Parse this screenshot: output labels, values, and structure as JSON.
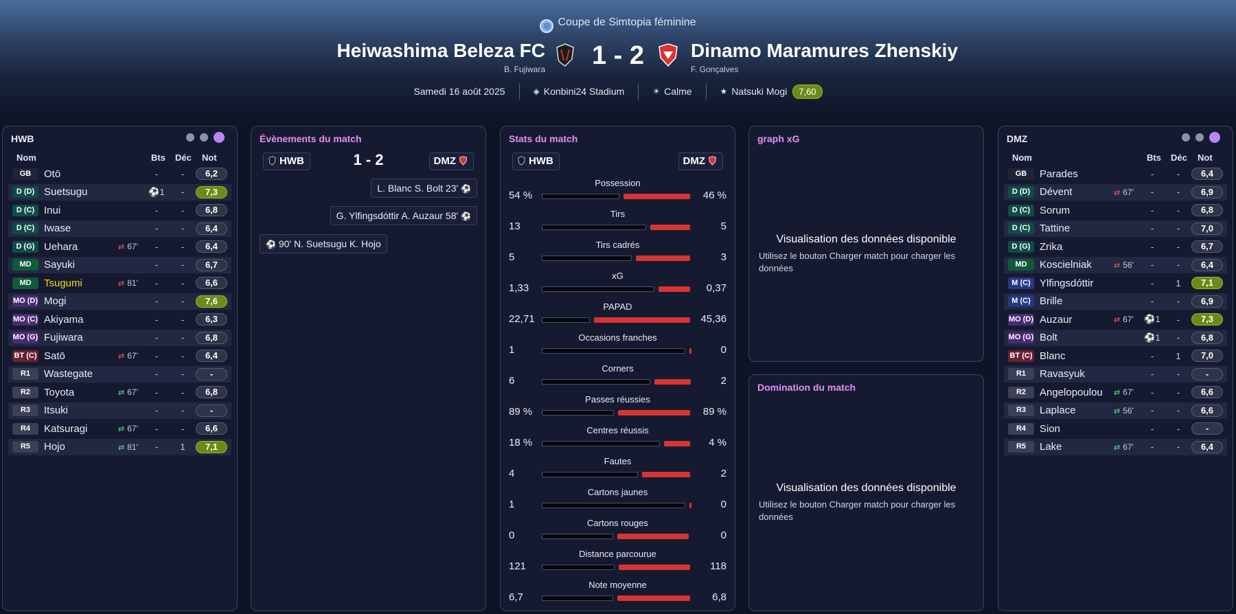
{
  "header": {
    "competition": "Coupe de Simtopia féminine",
    "home_team": "Heiwashima Beleza FC",
    "home_coach": "B. Fujiwara",
    "away_team": "Dinamo Maramures Zhenskiy",
    "away_coach": "F. Gonçalves",
    "score": "1 - 2",
    "date": "Samedi 16 août 2025",
    "stadium": "Konbini24 Stadium",
    "weather": "Calme",
    "motm_name": "Natsuki Mogi",
    "motm_rating": "7,60",
    "home_color": "#1c1c1c",
    "away_color": "#d83434"
  },
  "home_lineup": {
    "title": "HWB",
    "headers": {
      "name": "Nom",
      "goals": "Bts",
      "assists": "Déc",
      "rating": "Not"
    },
    "players": [
      {
        "pos": "GB",
        "name": "Otō",
        "sub": "",
        "goals": "-",
        "dec": "-",
        "rating": "6,2"
      },
      {
        "pos": "D (D)",
        "name": "Suetsugu",
        "sub": "",
        "goals": "⚽1",
        "dec": "-",
        "rating": "7,3"
      },
      {
        "pos": "D (C)",
        "name": "Inui",
        "sub": "",
        "goals": "-",
        "dec": "-",
        "rating": "6,8"
      },
      {
        "pos": "D (C)",
        "name": "Iwase",
        "sub": "",
        "goals": "-",
        "dec": "-",
        "rating": "6,4"
      },
      {
        "pos": "D (G)",
        "name": "Uehara",
        "sub": "67'",
        "goals": "-",
        "dec": "-",
        "rating": "6,4"
      },
      {
        "pos": "MD",
        "name": "Sayuki",
        "sub": "",
        "goals": "-",
        "dec": "-",
        "rating": "6,7"
      },
      {
        "pos": "MD",
        "name": "Tsugumi",
        "sub": "81'",
        "goals": "-",
        "dec": "-",
        "rating": "6,6"
      },
      {
        "pos": "MO (D)",
        "name": "Mogi",
        "sub": "",
        "goals": "-",
        "dec": "-",
        "rating": "7,6"
      },
      {
        "pos": "MO (C)",
        "name": "Akiyama",
        "sub": "",
        "goals": "-",
        "dec": "-",
        "rating": "6,3"
      },
      {
        "pos": "MO (G)",
        "name": "Fujiwara",
        "sub": "",
        "goals": "-",
        "dec": "-",
        "rating": "6,8"
      },
      {
        "pos": "BT (C)",
        "name": "Satō",
        "sub": "67'",
        "goals": "-",
        "dec": "-",
        "rating": "6,4"
      },
      {
        "pos": "R1",
        "name": "Wastegate",
        "sub": "",
        "goals": "-",
        "dec": "-",
        "rating": "-"
      },
      {
        "pos": "R2",
        "name": "Toyota",
        "sub": "67'",
        "goals": "-",
        "dec": "-",
        "rating": "6,8"
      },
      {
        "pos": "R3",
        "name": "Itsuki",
        "sub": "",
        "goals": "-",
        "dec": "-",
        "rating": "-"
      },
      {
        "pos": "R4",
        "name": "Katsuragi",
        "sub": "67'",
        "goals": "-",
        "dec": "-",
        "rating": "6,6"
      },
      {
        "pos": "R5",
        "name": "Hojo",
        "sub": "81'",
        "goals": "-",
        "dec": "1",
        "rating": "7,1"
      }
    ]
  },
  "away_lineup": {
    "title": "DMZ",
    "headers": {
      "name": "Nom",
      "goals": "Bts",
      "assists": "Déc",
      "rating": "Not"
    },
    "players": [
      {
        "pos": "GB",
        "name": "Parades",
        "sub": "",
        "goals": "-",
        "dec": "-",
        "rating": "6,4"
      },
      {
        "pos": "D (D)",
        "name": "Dévent",
        "sub": "67'",
        "goals": "-",
        "dec": "-",
        "rating": "6,9"
      },
      {
        "pos": "D (C)",
        "name": "Sorum",
        "sub": "",
        "goals": "-",
        "dec": "-",
        "rating": "6,8"
      },
      {
        "pos": "D (C)",
        "name": "Tattine",
        "sub": "",
        "goals": "-",
        "dec": "-",
        "rating": "7,0"
      },
      {
        "pos": "D (G)",
        "name": "Zrika",
        "sub": "",
        "goals": "-",
        "dec": "-",
        "rating": "6,7"
      },
      {
        "pos": "MD",
        "name": "Koscielniak",
        "sub": "56'",
        "goals": "-",
        "dec": "-",
        "rating": "6,4"
      },
      {
        "pos": "M (C)",
        "name": "Ylfingsdóttir",
        "sub": "",
        "goals": "-",
        "dec": "1",
        "rating": "7,1"
      },
      {
        "pos": "M (C)",
        "name": "Brille",
        "sub": "",
        "goals": "-",
        "dec": "-",
        "rating": "6,9"
      },
      {
        "pos": "MO (D)",
        "name": "Auzaur",
        "sub": "67'",
        "goals": "⚽1",
        "dec": "-",
        "rating": "7,3"
      },
      {
        "pos": "MO (G)",
        "name": "Bolt",
        "sub": "",
        "goals": "⚽1",
        "dec": "-",
        "rating": "6,8"
      },
      {
        "pos": "BT (C)",
        "name": "Blanc",
        "sub": "",
        "goals": "-",
        "dec": "1",
        "rating": "7,0"
      },
      {
        "pos": "R1",
        "name": "Ravasyuk",
        "sub": "",
        "goals": "-",
        "dec": "-",
        "rating": "-"
      },
      {
        "pos": "R2",
        "name": "Angelopoulou",
        "sub": "67'",
        "goals": "-",
        "dec": "-",
        "rating": "6,6"
      },
      {
        "pos": "R3",
        "name": "Laplace",
        "sub": "56'",
        "goals": "-",
        "dec": "-",
        "rating": "6,6"
      },
      {
        "pos": "R4",
        "name": "Sion",
        "sub": "",
        "goals": "-",
        "dec": "-",
        "rating": "-"
      },
      {
        "pos": "R5",
        "name": "Lake",
        "sub": "67'",
        "goals": "-",
        "dec": "-",
        "rating": "6,4"
      }
    ]
  },
  "events": {
    "title": "Évènements du match",
    "home_tag": "HWB",
    "away_tag": "DMZ",
    "score": "1 - 2",
    "list": [
      {
        "side": "away",
        "text": "L. Blanc  S. Bolt  23'"
      },
      {
        "side": "away",
        "text": "G. Ylfingsdóttir  A. Auzaur  58'"
      },
      {
        "side": "home",
        "text": "90'  N. Suetsugu  K. Hojo"
      }
    ]
  },
  "stats": {
    "title": "Stats du match",
    "home_tag": "HWB",
    "away_tag": "DMZ",
    "rows": [
      {
        "label": "Possession",
        "home": "54 %",
        "away": "46 %",
        "h": 54,
        "a": 46
      },
      {
        "label": "Tirs",
        "home": "13",
        "away": "5",
        "h": 13,
        "a": 5
      },
      {
        "label": "Tirs cadrés",
        "home": "5",
        "away": "3",
        "h": 5,
        "a": 3
      },
      {
        "label": "xG",
        "home": "1,33",
        "away": "0,37",
        "h": 1.33,
        "a": 0.37
      },
      {
        "label": "PAPAD",
        "home": "22,71",
        "away": "45,36",
        "h": 22.71,
        "a": 45.36
      },
      {
        "label": "Occasions franches",
        "home": "1",
        "away": "0",
        "h": 1,
        "a": 0
      },
      {
        "label": "Corners",
        "home": "6",
        "away": "2",
        "h": 6,
        "a": 2
      },
      {
        "label": "Passes réussies",
        "home": "89 %",
        "away": "89 %",
        "h": 89,
        "a": 89
      },
      {
        "label": "Centres réussis",
        "home": "18 %",
        "away": "4 %",
        "h": 18,
        "a": 4
      },
      {
        "label": "Fautes",
        "home": "4",
        "away": "2",
        "h": 4,
        "a": 2
      },
      {
        "label": "Cartons jaunes",
        "home": "1",
        "away": "0",
        "h": 1,
        "a": 0
      },
      {
        "label": "Cartons rouges",
        "home": "0",
        "away": "0",
        "h": 0,
        "a": 0
      },
      {
        "label": "Distance parcourue",
        "home": "121",
        "away": "118",
        "h": 121,
        "a": 118
      },
      {
        "label": "Note moyenne",
        "home": "6,7",
        "away": "6,8",
        "h": 6.7,
        "a": 6.8
      }
    ]
  },
  "xg_panel": {
    "title": "graph xG",
    "msg_title": "Visualisation des données disponible",
    "msg_sub": "Utilisez le bouton Charger match pour charger les données"
  },
  "dom_panel": {
    "title": "Domination du match",
    "msg_title": "Visualisation des données disponible",
    "msg_sub": "Utilisez le bouton Charger match pour charger les données"
  }
}
